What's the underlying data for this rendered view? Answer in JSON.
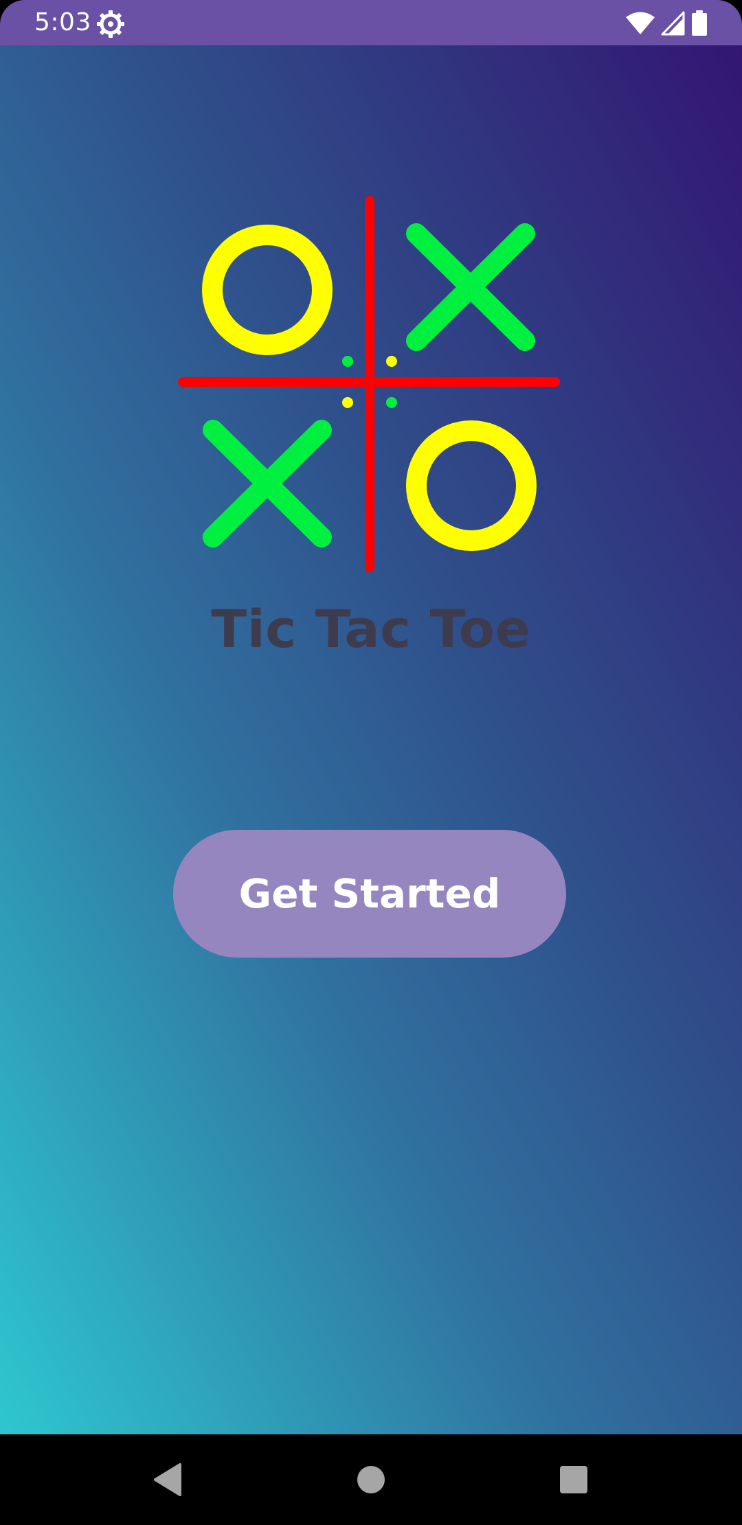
{
  "status_bar": {
    "time": "5:03",
    "icons": [
      "settings-gear-icon",
      "wifi-icon",
      "cell-signal-icon",
      "battery-icon"
    ],
    "background_color": "#6a51a6"
  },
  "logo": {
    "board": [
      "O",
      "X",
      "X",
      "O"
    ],
    "colors": {
      "grid": "#ff0000",
      "o_mark": "#ffff00",
      "x_mark": "#00f040"
    }
  },
  "app_title": "Tic Tac Toe",
  "get_started_button": {
    "label": "Get Started",
    "color": "#9686c0"
  },
  "navigation_bar": {
    "buttons": [
      "back-icon",
      "home-icon",
      "recents-icon"
    ]
  },
  "theme": {
    "gradient_colors": [
      "#2ec7cf",
      "#3071a0",
      "#2f4f8a",
      "#331672"
    ]
  }
}
